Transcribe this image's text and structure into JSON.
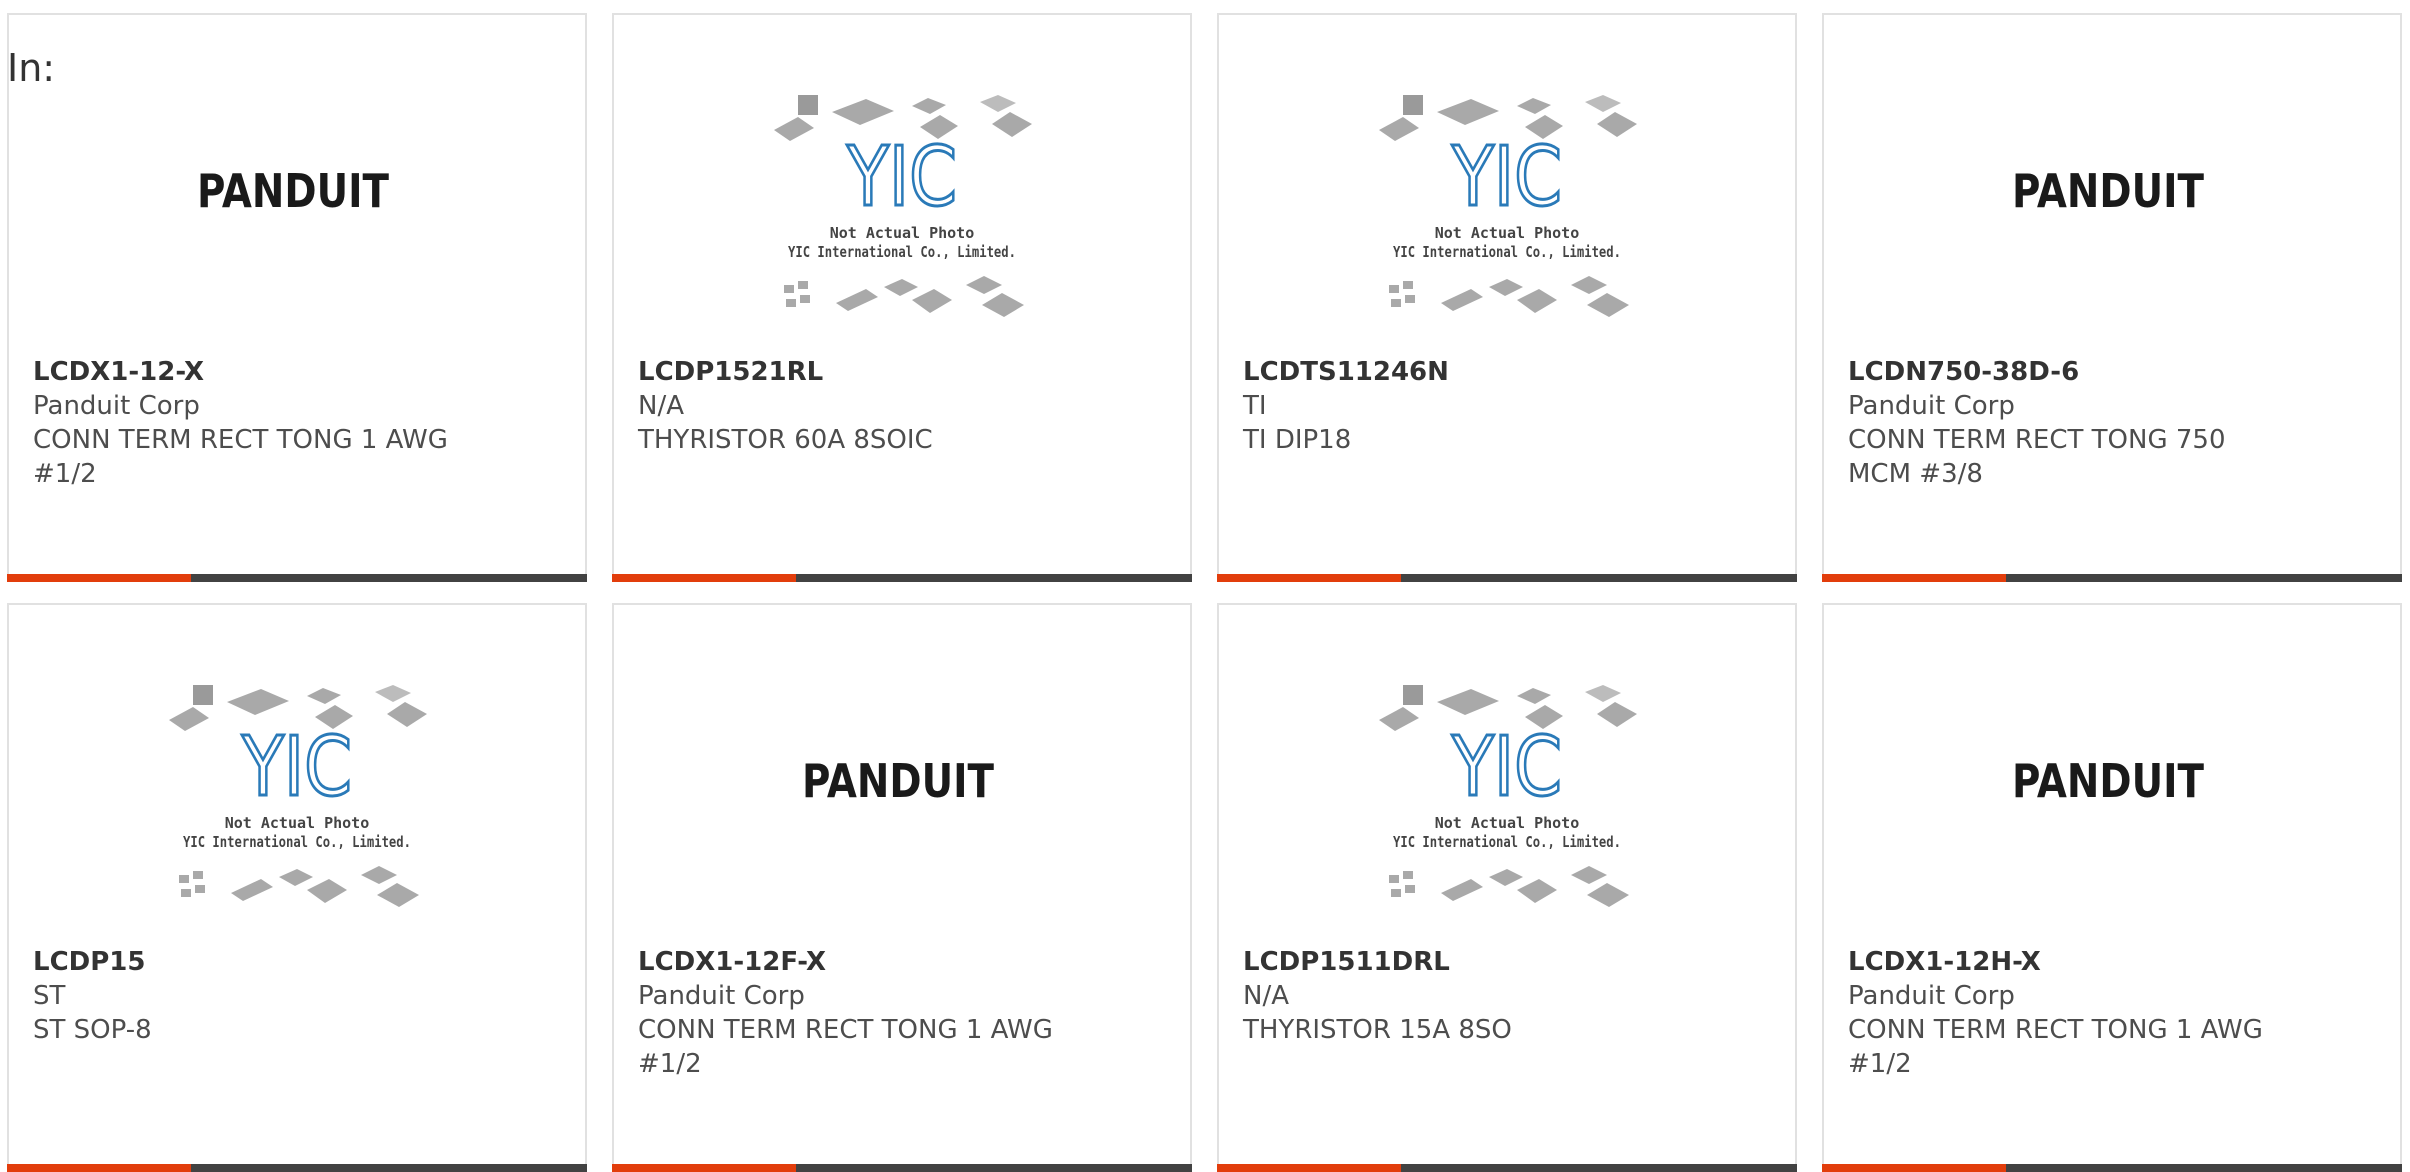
{
  "filter": {
    "in_label": "In:"
  },
  "logos": {
    "panduit": "PANDUIT",
    "yic_mark": "YIC",
    "yic_caption_1": "Not Actual Photo",
    "yic_caption_2": "YIC International Co., Limited."
  },
  "colors": {
    "accent": "#e23d0c",
    "bar": "#424242",
    "border": "#e1e1e1",
    "yic_blue": "#2a7ab8"
  },
  "products": [
    {
      "part_number": "LCDX1-12-X",
      "manufacturer": "Panduit Corp",
      "description": "CONN TERM RECT TONG 1 AWG #1/2",
      "image": "panduit-logo"
    },
    {
      "part_number": "LCDP1521RL",
      "manufacturer": "N/A",
      "description": "THYRISTOR 60A 8SOIC",
      "image": "yic-placeholder"
    },
    {
      "part_number": "LCDTS11246N",
      "manufacturer": "TI",
      "description": "TI DIP18",
      "image": "yic-placeholder"
    },
    {
      "part_number": "LCDN750-38D-6",
      "manufacturer": "Panduit Corp",
      "description": "CONN TERM RECT TONG 750 MCM #3/8",
      "image": "panduit-logo"
    },
    {
      "part_number": "LCDP15",
      "manufacturer": "ST",
      "description": "ST SOP-8",
      "image": "yic-placeholder"
    },
    {
      "part_number": "LCDX1-12F-X",
      "manufacturer": "Panduit Corp",
      "description": "CONN TERM RECT TONG 1 AWG #1/2",
      "image": "panduit-logo"
    },
    {
      "part_number": "LCDP1511DRL",
      "manufacturer": "N/A",
      "description": "THYRISTOR 15A 8SO",
      "image": "yic-placeholder"
    },
    {
      "part_number": "LCDX1-12H-X",
      "manufacturer": "Panduit Corp",
      "description": "CONN TERM RECT TONG 1 AWG #1/2",
      "image": "panduit-logo"
    }
  ]
}
